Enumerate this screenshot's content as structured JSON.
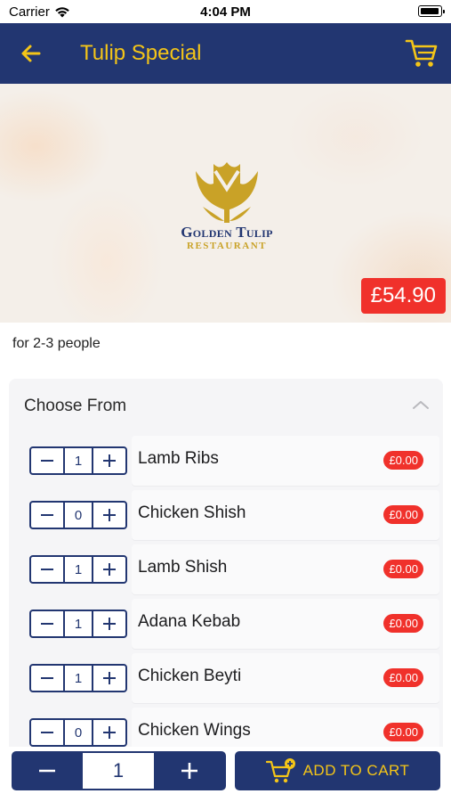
{
  "status_bar": {
    "carrier": "Carrier",
    "time": "4:04 PM"
  },
  "header": {
    "title": "Tulip Special"
  },
  "hero": {
    "logo_line1": "Golden Tulip",
    "logo_line2": "RESTAURANT",
    "price": "£54.90"
  },
  "description": "for 2-3 people",
  "panel": {
    "title": "Choose From",
    "items": [
      {
        "name": "Lamb Ribs",
        "qty": "1",
        "price": "£0.00"
      },
      {
        "name": "Chicken Shish",
        "qty": "0",
        "price": "£0.00"
      },
      {
        "name": "Lamb Shish",
        "qty": "1",
        "price": "£0.00"
      },
      {
        "name": "Adana Kebab",
        "qty": "1",
        "price": "£0.00"
      },
      {
        "name": "Chicken Beyti",
        "qty": "1",
        "price": "£0.00"
      },
      {
        "name": "Chicken Wings",
        "qty": "0",
        "price": "£0.00"
      }
    ]
  },
  "bottom": {
    "quantity": "1",
    "add_to_cart": "ADD TO CART"
  },
  "colors": {
    "brand_navy": "#223671",
    "accent_yellow": "#f4c518",
    "price_red": "#f0312b",
    "logo_gold": "#c9a227"
  }
}
